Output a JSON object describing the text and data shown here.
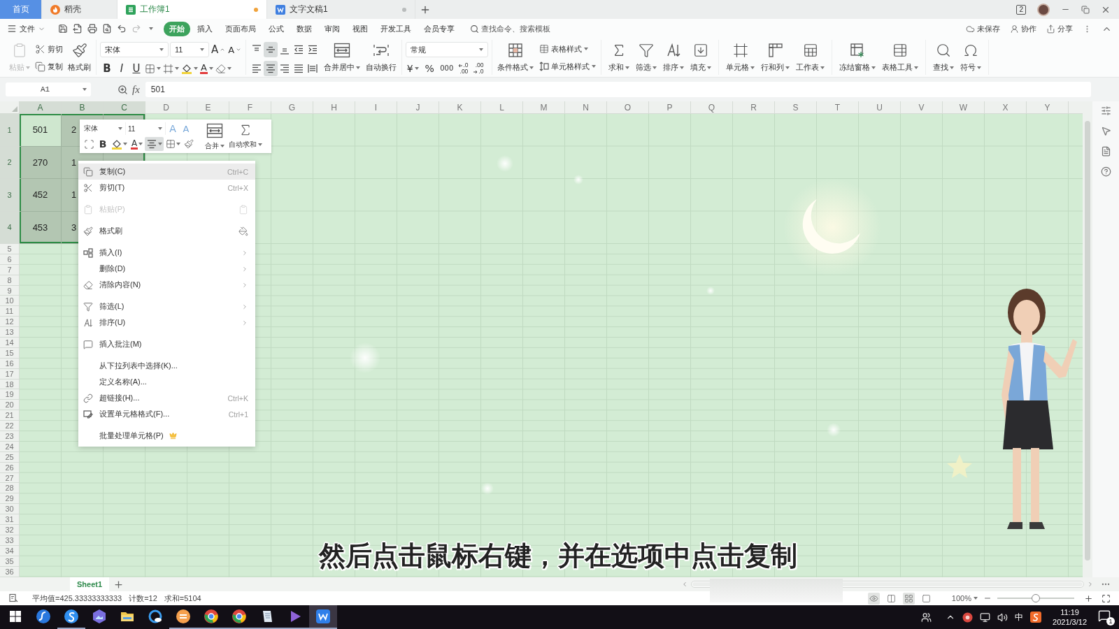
{
  "title_bar": {
    "tabs": [
      {
        "label": "首页",
        "kind": "home",
        "selected": false,
        "modified": false
      },
      {
        "label": "稻壳",
        "kind": "docer",
        "selected": false,
        "modified": false
      },
      {
        "label": "工作簿1",
        "kind": "sheet",
        "selected": true,
        "modified": true
      },
      {
        "label": "文字文稿1",
        "kind": "writer",
        "selected": false,
        "modified": true
      }
    ],
    "window_count": "2"
  },
  "menu_bar": {
    "file": "文件",
    "tabs": [
      {
        "label": "开始",
        "selected": true
      },
      {
        "label": "插入",
        "selected": false
      },
      {
        "label": "页面布局",
        "selected": false
      },
      {
        "label": "公式",
        "selected": false
      },
      {
        "label": "数据",
        "selected": false
      },
      {
        "label": "审阅",
        "selected": false
      },
      {
        "label": "视图",
        "selected": false
      },
      {
        "label": "开发工具",
        "selected": false
      },
      {
        "label": "会员专享",
        "selected": false
      }
    ],
    "search": {
      "placeholder": "查找命令、搜索模板"
    },
    "actions": [
      {
        "kind": "cloud",
        "label": "未保存"
      },
      {
        "kind": "collaborate",
        "label": "协作"
      },
      {
        "kind": "share",
        "label": "分享"
      }
    ]
  },
  "ribbon": {
    "clipboard": {
      "paste": {
        "label": "粘贴",
        "disabled": true
      },
      "cut": "剪切",
      "copy": "复制",
      "format_painter": "格式刷"
    },
    "font": {
      "name": "宋体",
      "size": "11",
      "grow": "A",
      "shrink": "A",
      "bold": "B",
      "italic": "I",
      "underline": "U",
      "font_color": "A"
    },
    "alignment": {
      "rows": [
        [
          {
            "kind": "top",
            "selected": false
          },
          {
            "kind": "middle",
            "selected": true
          },
          {
            "kind": "bottom",
            "selected": false
          },
          {
            "kind": "indent_less",
            "selected": false
          },
          {
            "kind": "indent_more",
            "selected": false
          }
        ],
        [
          {
            "kind": "left",
            "selected": false
          },
          {
            "kind": "center",
            "selected": true
          },
          {
            "kind": "right",
            "selected": false
          },
          {
            "kind": "justify",
            "selected": false
          },
          {
            "kind": "distributed",
            "selected": false
          }
        ]
      ],
      "merge": "合并居中",
      "wrap": "自动换行"
    },
    "number": {
      "format": "常规",
      "currency": "¥",
      "percent": "%",
      "thousands": "000",
      "decimals": [
        {
          "kind": "increase",
          "top": ".0",
          "bottom": ".00"
        },
        {
          "kind": "decrease",
          "top": ".00",
          "bottom": ".0"
        }
      ]
    },
    "styles": {
      "conditional": "条件格式",
      "table_style": "表格样式",
      "cell_style": "单元格样式"
    },
    "tool_groups": [
      [
        {
          "kind": "sum",
          "label": "求和"
        },
        {
          "kind": "filter",
          "label": "筛选"
        },
        {
          "kind": "sort",
          "label": "排序"
        },
        {
          "kind": "fill",
          "label": "填充"
        }
      ],
      [
        {
          "kind": "cell",
          "label": "单元格"
        },
        {
          "kind": "row_col",
          "label": "行和列"
        },
        {
          "kind": "sheet",
          "label": "工作表"
        }
      ],
      [
        {
          "kind": "freeze",
          "label": "冻结窗格"
        },
        {
          "kind": "table_tools",
          "label": "表格工具"
        }
      ],
      [
        {
          "kind": "find",
          "label": "查找"
        },
        {
          "kind": "symbol",
          "label": "符号"
        }
      ]
    ]
  },
  "formula_bar": {
    "name_box": "A1",
    "fx": "fx",
    "value": "501"
  },
  "sheet": {
    "columns": [
      {
        "label": "A",
        "selected": true
      },
      {
        "label": "B",
        "selected": true
      },
      {
        "label": "C",
        "selected": true
      },
      {
        "label": "D",
        "selected": false
      },
      {
        "label": "E",
        "selected": false
      },
      {
        "label": "F",
        "selected": false
      },
      {
        "label": "G",
        "selected": false
      },
      {
        "label": "H",
        "selected": false
      },
      {
        "label": "I",
        "selected": false
      },
      {
        "label": "J",
        "selected": false
      },
      {
        "label": "K",
        "selected": false
      },
      {
        "label": "L",
        "selected": false
      },
      {
        "label": "M",
        "selected": false
      },
      {
        "label": "N",
        "selected": false
      },
      {
        "label": "O",
        "selected": false
      },
      {
        "label": "P",
        "selected": false
      },
      {
        "label": "Q",
        "selected": false
      },
      {
        "label": "R",
        "selected": false
      },
      {
        "label": "S",
        "selected": false
      },
      {
        "label": "T",
        "selected": false
      },
      {
        "label": "U",
        "selected": false
      },
      {
        "label": "V",
        "selected": false
      },
      {
        "label": "W",
        "selected": false
      },
      {
        "label": "X",
        "selected": false
      },
      {
        "label": "Y",
        "selected": false
      }
    ],
    "rows": [
      {
        "label": "1",
        "selected": true,
        "cells": [
          {
            "value": "501",
            "selected": true,
            "active": true
          },
          {
            "value": "2",
            "selected": true,
            "active": false
          },
          {
            "selected": true,
            "active": false
          }
        ]
      },
      {
        "label": "2",
        "selected": true,
        "cells": [
          {
            "value": "270",
            "selected": true,
            "active": false
          },
          {
            "value": "1",
            "selected": true,
            "active": false
          },
          {
            "selected": true,
            "active": false
          }
        ]
      },
      {
        "label": "3",
        "selected": true,
        "cells": [
          {
            "value": "452",
            "selected": true,
            "active": false
          },
          {
            "value": "1",
            "selected": true,
            "active": false
          }
        ]
      },
      {
        "label": "4",
        "selected": true,
        "cells": [
          {
            "value": "453",
            "selected": true,
            "active": false
          },
          {
            "value": "3",
            "selected": true,
            "active": false
          }
        ]
      },
      {
        "label": "5",
        "selected": false
      },
      {
        "label": "6",
        "selected": false
      },
      {
        "label": "7",
        "selected": false
      },
      {
        "label": "8",
        "selected": false
      },
      {
        "label": "9",
        "selected": false
      },
      {
        "label": "10",
        "selected": false
      },
      {
        "label": "11",
        "selected": false
      },
      {
        "label": "12",
        "selected": false
      },
      {
        "label": "13",
        "selected": false
      },
      {
        "label": "14",
        "selected": false
      },
      {
        "label": "15",
        "selected": false
      },
      {
        "label": "16",
        "selected": false
      },
      {
        "label": "17",
        "selected": false
      },
      {
        "label": "18",
        "selected": false
      },
      {
        "label": "19",
        "selected": false
      },
      {
        "label": "20",
        "selected": false
      },
      {
        "label": "21",
        "selected": false
      },
      {
        "label": "22",
        "selected": false
      },
      {
        "label": "23",
        "selected": false
      },
      {
        "label": "24",
        "selected": false
      },
      {
        "label": "25",
        "selected": false
      },
      {
        "label": "26",
        "selected": false
      },
      {
        "label": "27",
        "selected": false
      },
      {
        "label": "28",
        "selected": false
      },
      {
        "label": "29",
        "selected": false
      },
      {
        "label": "30",
        "selected": false
      },
      {
        "label": "31",
        "selected": false
      },
      {
        "label": "32",
        "selected": false
      },
      {
        "label": "33",
        "selected": false
      },
      {
        "label": "34",
        "selected": false
      },
      {
        "label": "35",
        "selected": false
      },
      {
        "label": "36",
        "selected": false
      }
    ]
  },
  "mini_toolbar": {
    "font": "宋体",
    "size": "11",
    "grow": "A",
    "shrink": "A",
    "buttons": [
      {
        "kind": "select",
        "selected": false
      },
      {
        "kind": "bold",
        "label": "B",
        "selected": false
      },
      {
        "kind": "fill",
        "selected": false
      },
      {
        "kind": "font_color",
        "label": "A",
        "selected": false
      },
      {
        "kind": "align",
        "selected": true
      },
      {
        "kind": "border",
        "selected": false
      },
      {
        "kind": "painter",
        "selected": false
      }
    ],
    "merge": "合并",
    "autosum": "自动求和"
  },
  "context_menu": {
    "groups": [
      [
        {
          "kind": "copy",
          "label": "复制(C)",
          "shortcut": "Ctrl+C",
          "selected": true,
          "disabled": false,
          "submenu": false
        },
        {
          "kind": "cut",
          "label": "剪切(T)",
          "shortcut": "Ctrl+X",
          "selected": false,
          "disabled": false,
          "submenu": false
        }
      ],
      [
        {
          "kind": "paste",
          "label": "粘贴(P)",
          "selected": false,
          "disabled": true,
          "submenu": false
        }
      ],
      [
        {
          "kind": "format_painter",
          "label": "格式刷",
          "selected": false,
          "disabled": false,
          "submenu": false
        }
      ],
      [
        {
          "kind": "insert",
          "label": "插入(I)",
          "selected": false,
          "disabled": false,
          "submenu": true
        },
        {
          "kind": "plain",
          "label": "删除(D)",
          "selected": false,
          "disabled": false,
          "submenu": true
        },
        {
          "kind": "clear",
          "label": "清除内容(N)",
          "selected": false,
          "disabled": false,
          "submenu": true
        }
      ],
      [
        {
          "kind": "filter",
          "label": "筛选(L)",
          "selected": false,
          "disabled": false,
          "submenu": true
        },
        {
          "kind": "sort",
          "label": "排序(U)",
          "selected": false,
          "disabled": false,
          "submenu": true
        }
      ],
      [
        {
          "kind": "comment",
          "label": "插入批注(M)",
          "selected": false,
          "disabled": false,
          "submenu": false
        }
      ],
      [
        {
          "kind": "plain",
          "label": "从下拉列表中选择(K)...",
          "selected": false,
          "disabled": false,
          "submenu": false
        },
        {
          "kind": "plain",
          "label": "定义名称(A)...",
          "selected": false,
          "disabled": false,
          "submenu": false
        },
        {
          "kind": "link",
          "label": "超链接(H)...",
          "shortcut": "Ctrl+K",
          "selected": false,
          "disabled": false,
          "submenu": false
        },
        {
          "kind": "format_cells",
          "label": "设置单元格格式(F)...",
          "shortcut": "Ctrl+1",
          "selected": false,
          "disabled": false,
          "submenu": false
        }
      ],
      [
        {
          "kind": "batch",
          "label": "批量处理单元格(P)",
          "selected": false,
          "disabled": false,
          "submenu": false
        }
      ]
    ]
  },
  "subtitle": "然后点击鼠标右键，并在选项中点击复制",
  "sheet_tabs": [
    {
      "label": "Sheet1",
      "selected": true
    }
  ],
  "status_bar": {
    "stats": [
      "平均值=425.33333333333",
      "计数=12",
      "求和=5104"
    ],
    "views": [
      {
        "kind": "eye",
        "selected": true
      },
      {
        "kind": "split",
        "selected": false
      },
      {
        "kind": "normal",
        "selected": true
      },
      {
        "kind": "page",
        "selected": false
      }
    ],
    "zoom": "100%",
    "zoom_slider": {
      "level": 0.5
    }
  },
  "taskbar": {
    "apps": [
      {
        "kind": "swirl_disc",
        "running": false,
        "active": false
      },
      {
        "kind": "curve_disc",
        "running": true,
        "active": false
      },
      {
        "kind": "hexagon",
        "running": false,
        "active": false
      },
      {
        "kind": "folder",
        "running": false,
        "active": false
      },
      {
        "kind": "ring",
        "running": false,
        "active": false
      },
      {
        "kind": "orange_disc",
        "running": true,
        "active": false
      },
      {
        "kind": "globe",
        "running": true,
        "active": false
      },
      {
        "kind": "globe",
        "running": true,
        "active": false
      },
      {
        "kind": "notepad",
        "running": true,
        "active": false
      },
      {
        "kind": "play",
        "running": true,
        "active": false
      },
      {
        "kind": "square",
        "running": true,
        "active": true
      }
    ],
    "ime": "中",
    "time": "11:19",
    "date": "2021/3/12",
    "notifications": "1"
  }
}
